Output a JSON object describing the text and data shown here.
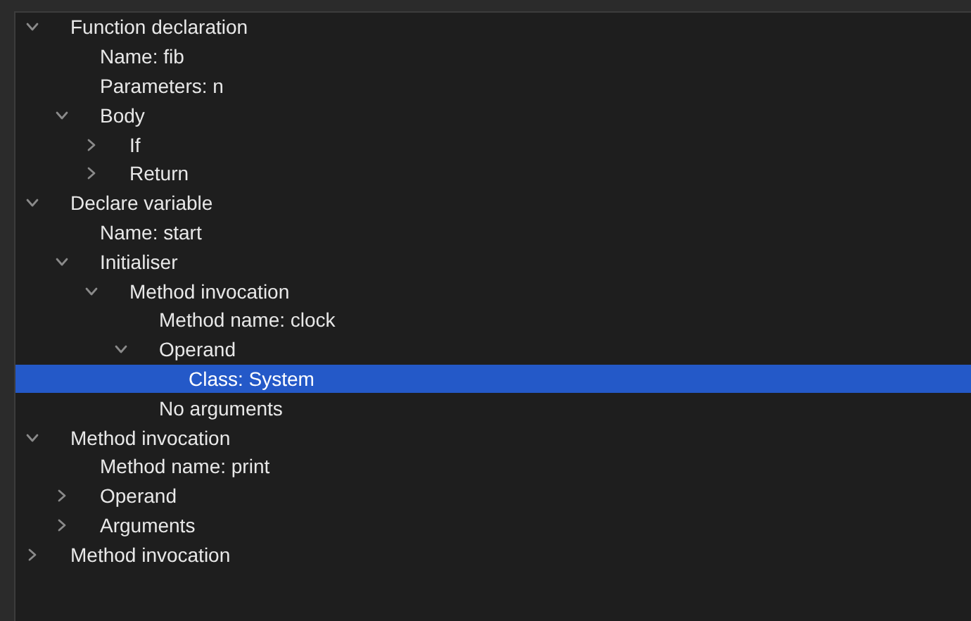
{
  "tree": [
    {
      "label": "Function declaration",
      "expanded": true,
      "selected": false,
      "children": [
        {
          "label": "Name: fib",
          "selected": false
        },
        {
          "label": "Parameters: n",
          "selected": false
        },
        {
          "label": "Body",
          "expanded": true,
          "selected": false,
          "children": [
            {
              "label": "If",
              "expanded": false,
              "selected": false
            },
            {
              "label": "Return",
              "expanded": false,
              "selected": false
            }
          ]
        }
      ]
    },
    {
      "label": "Declare variable",
      "expanded": true,
      "selected": false,
      "children": [
        {
          "label": "Name: start",
          "selected": false
        },
        {
          "label": "Initialiser",
          "expanded": true,
          "selected": false,
          "children": [
            {
              "label": "Method invocation",
              "expanded": true,
              "selected": false,
              "children": [
                {
                  "label": "Method name: clock",
                  "selected": false
                },
                {
                  "label": "Operand",
                  "expanded": true,
                  "selected": false,
                  "children": [
                    {
                      "label": "Class: System",
                      "selected": true
                    }
                  ]
                },
                {
                  "label": "No arguments",
                  "selected": false
                }
              ]
            }
          ]
        }
      ]
    },
    {
      "label": "Method invocation",
      "expanded": true,
      "selected": false,
      "children": [
        {
          "label": "Method name: print",
          "selected": false
        },
        {
          "label": "Operand",
          "expanded": false,
          "selected": false
        },
        {
          "label": "Arguments",
          "expanded": false,
          "selected": false
        }
      ]
    },
    {
      "label": "Method invocation",
      "expanded": false,
      "selected": false
    }
  ]
}
